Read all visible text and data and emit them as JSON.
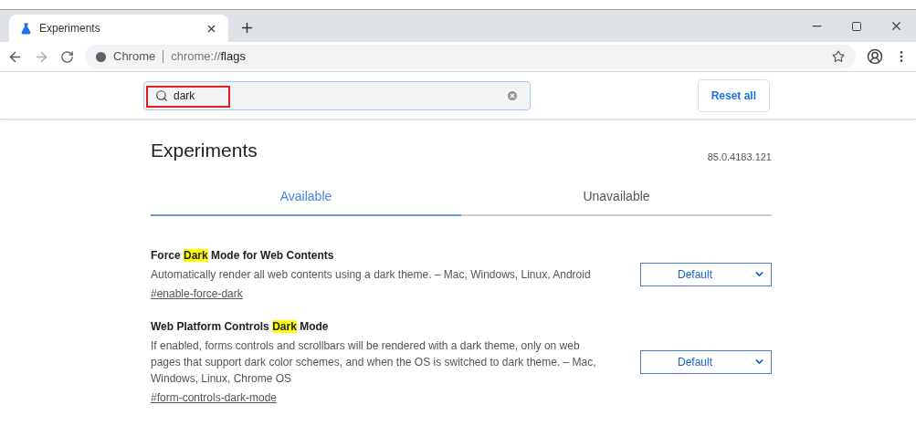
{
  "tab": {
    "title": "Experiments"
  },
  "address": {
    "site": "Chrome",
    "url_prefix": "chrome://",
    "url_path": "flags"
  },
  "search": {
    "value": "dark",
    "marked": true
  },
  "reset_button": "Reset all",
  "heading": "Experiments",
  "version": "85.0.4183.121",
  "tabs": [
    {
      "label": "Available",
      "selected": true
    },
    {
      "label": "Unavailable",
      "selected": false
    }
  ],
  "experiments": [
    {
      "title": [
        {
          "text": "Force ",
          "highlight": false
        },
        {
          "text": "Dark",
          "highlight": true
        },
        {
          "text": " Mode for Web Contents",
          "highlight": false
        }
      ],
      "description": "Automatically render all web contents using a dark theme. – Mac, Windows, Linux, Android",
      "link": "#enable-force-dark",
      "value": "Default"
    },
    {
      "title": [
        {
          "text": "Web Platform Controls ",
          "highlight": false
        },
        {
          "text": "Dark",
          "highlight": true
        },
        {
          "text": " Mode",
          "highlight": false
        }
      ],
      "description": "If enabled, forms controls and scrollbars will be rendered with a dark theme, only on web pages that support dark color schemes, and when the OS is switched to dark theme. – Mac, Windows, Linux, Chrome OS",
      "link": "#form-controls-dark-mode",
      "value": "Default"
    }
  ]
}
